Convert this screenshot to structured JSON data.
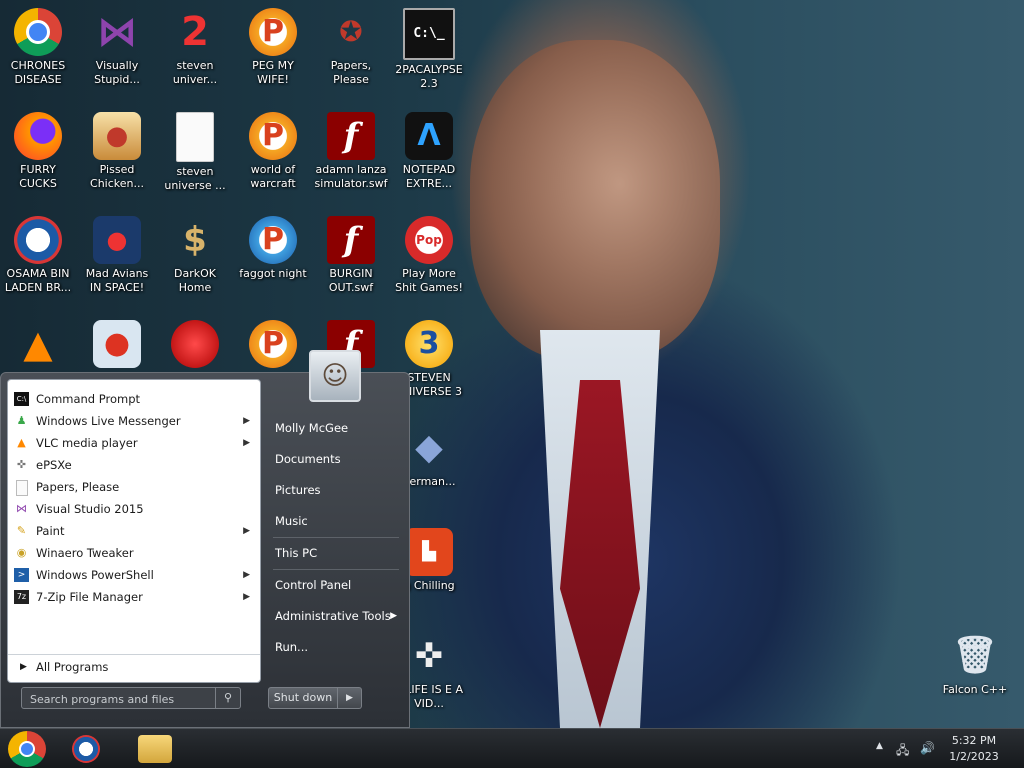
{
  "desktop_icons": [
    {
      "label": "CHRONES DISEASE",
      "icon": "chrome-icon"
    },
    {
      "label": "Visually Stupid...",
      "icon": "visual-studio-icon"
    },
    {
      "label": "steven univer...",
      "icon": "steven-universe-2-icon"
    },
    {
      "label": "PEG MY WIFE!",
      "icon": "peggle-icon"
    },
    {
      "label": "Papers, Please",
      "icon": "papers-please-icon"
    },
    {
      "label": "2PACALYPSE 2.3",
      "icon": "command-prompt-icon"
    },
    {
      "label": "FURRY CUCKS",
      "icon": "firefox-icon"
    },
    {
      "label": "Pissed Chicken...",
      "icon": "angry-birds-seasons-icon"
    },
    {
      "label": "steven universe ...",
      "icon": "blank-file-icon"
    },
    {
      "label": "world of warcraft",
      "icon": "peggle-icon"
    },
    {
      "label": "adamn lanza simulator.swf",
      "icon": "flash-icon"
    },
    {
      "label": "NOTEPAD EXTRE...",
      "icon": "notepad-icon"
    },
    {
      "label": "OSAMA BIN LADEN BR...",
      "icon": "obama-logo-icon"
    },
    {
      "label": "Mad Avians IN SPACE!",
      "icon": "angry-birds-space-icon"
    },
    {
      "label": "DarkOK Home",
      "icon": "money-bag-icon"
    },
    {
      "label": "faggot night",
      "icon": "peggle-nights-icon"
    },
    {
      "label": "BURGIN OUT.swf",
      "icon": "flash-icon"
    },
    {
      "label": "Play More Shit Games!",
      "icon": "popcap-icon"
    },
    {
      "label": "",
      "icon": "vlc-icon"
    },
    {
      "label": "",
      "icon": "angry-birds-icon"
    },
    {
      "label": "",
      "icon": "red-creature-icon"
    },
    {
      "label": "",
      "icon": "peggle-icon"
    },
    {
      "label": "",
      "icon": "flash-icon"
    },
    {
      "label": "STEVEN UNIVERSE 3",
      "icon": "steven-universe-3-icon"
    },
    {
      "label": "derman...",
      "icon": "diamond-icon"
    },
    {
      "label": "g Chilling",
      "icon": "chilling-icon"
    },
    {
      "label": "Y LIFE IS E A VID...",
      "icon": "gamepad-icon"
    },
    {
      "label": "Falcon C++",
      "icon": "recycle-bin-icon"
    }
  ],
  "start_menu": {
    "programs": [
      {
        "label": "Command Prompt",
        "icon": "command-prompt-icon",
        "submenu": false
      },
      {
        "label": "Windows Live Messenger",
        "icon": "messenger-icon",
        "submenu": true
      },
      {
        "label": "VLC media player",
        "icon": "vlc-icon",
        "submenu": true
      },
      {
        "label": "ePSXe",
        "icon": "gamepad-icon",
        "submenu": false
      },
      {
        "label": "Papers, Please",
        "icon": "blank-file-icon",
        "submenu": false
      },
      {
        "label": "Visual Studio 2015",
        "icon": "visual-studio-icon",
        "submenu": false
      },
      {
        "label": "Paint",
        "icon": "paint-icon",
        "submenu": true
      },
      {
        "label": "Winaero Tweaker",
        "icon": "tweaker-icon",
        "submenu": false
      },
      {
        "label": "Windows PowerShell",
        "icon": "powershell-icon",
        "submenu": true
      },
      {
        "label": "7-Zip File Manager",
        "icon": "seven-zip-icon",
        "submenu": true
      }
    ],
    "all_programs": "All Programs",
    "search_placeholder": "Search programs and files",
    "places": [
      {
        "label": "Molly McGee"
      },
      {
        "label": "Documents"
      },
      {
        "label": "Pictures"
      },
      {
        "label": "Music"
      },
      {
        "label": "This PC"
      },
      {
        "label": "Control Panel"
      },
      {
        "label": "Administrative Tools",
        "submenu": true
      },
      {
        "label": "Run..."
      }
    ],
    "shutdown": "Shut down"
  },
  "taskbar": {
    "time": "5:32 PM",
    "date": "1/2/2023"
  }
}
